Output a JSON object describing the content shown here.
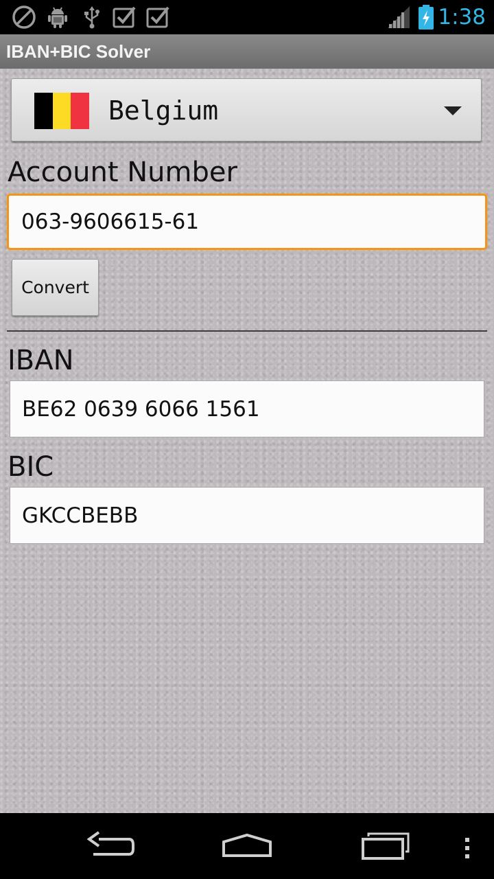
{
  "status_bar": {
    "time": "1:38",
    "icons": [
      "blocked-icon",
      "android-debug-icon",
      "usb-icon",
      "checkbox-icon",
      "checkbox-icon",
      "signal-icon",
      "battery-charging-icon"
    ]
  },
  "app": {
    "title": "IBAN+BIC Solver"
  },
  "country_spinner": {
    "selected": "Belgium",
    "flag_colors": [
      "#000000",
      "#FDDA24",
      "#EF3340"
    ]
  },
  "account": {
    "label": "Account Number",
    "value": "063-9606615-61"
  },
  "convert_button": {
    "label": "Convert"
  },
  "iban": {
    "label": "IBAN",
    "value": "BE62 0639 6066 1561"
  },
  "bic": {
    "label": "BIC",
    "value": "GKCCBEBB"
  },
  "navigation": {
    "buttons": [
      "back-icon",
      "home-icon",
      "recent-apps-icon",
      "overflow-menu-icon"
    ]
  },
  "colors": {
    "accent_clock": "#33b5e5",
    "focus_border": "#f0961e"
  }
}
